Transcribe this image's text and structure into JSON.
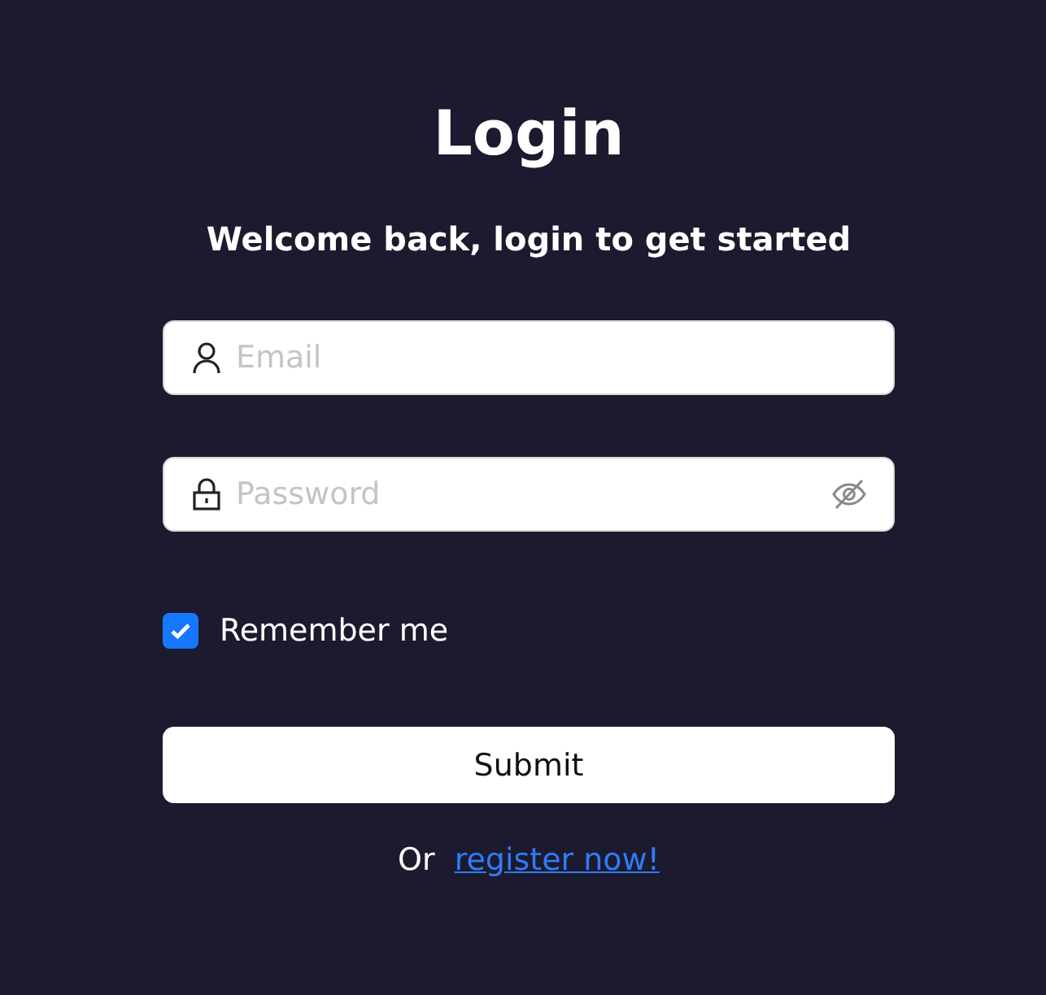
{
  "title": "Login",
  "subtitle": "Welcome back, login to get started",
  "email": {
    "placeholder": "Email"
  },
  "password": {
    "placeholder": "Password"
  },
  "remember": {
    "label": "Remember me",
    "checked": true
  },
  "submit": "Submit",
  "footer": {
    "text": "Or",
    "link": "register now!"
  }
}
